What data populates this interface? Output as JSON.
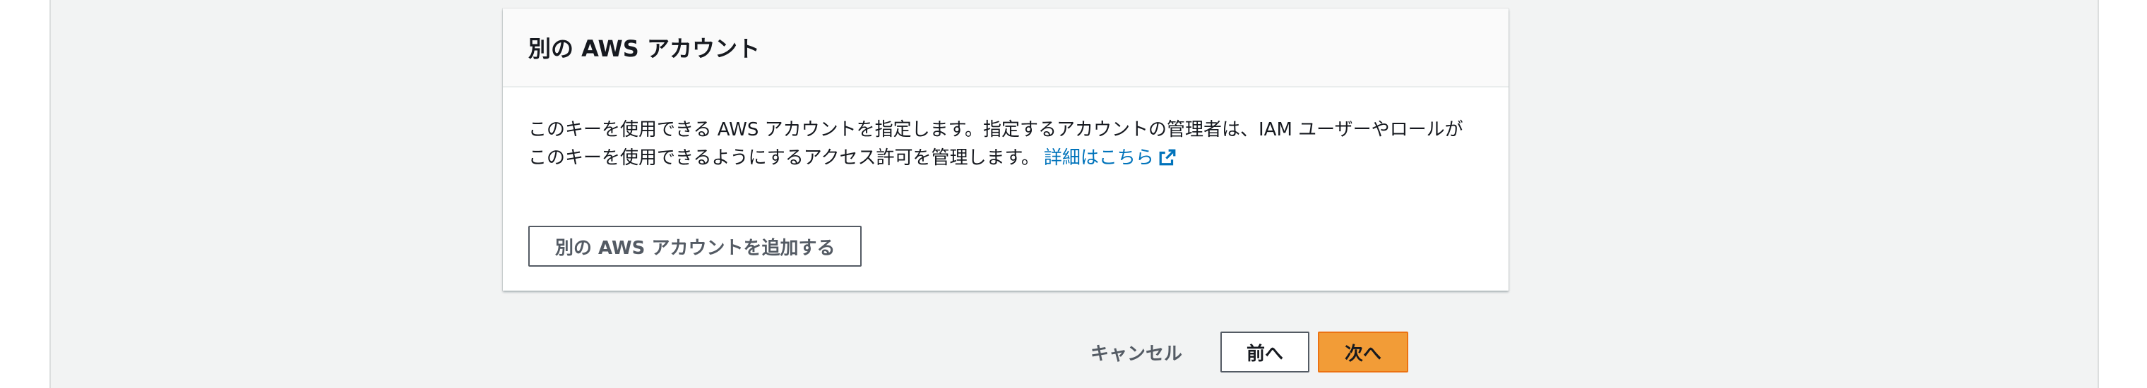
{
  "panel": {
    "title": "別の AWS アカウント",
    "description": "このキーを使用できる AWS アカウントを指定します。指定するアカウントの管理者は、IAM ユーザーやロールがこのキーを使用できるようにするアクセス許可を管理します。",
    "learn_more_label": "詳細はこちら",
    "add_account_label": "別の AWS アカウントを追加する"
  },
  "footer": {
    "cancel_label": "キャンセル",
    "previous_label": "前へ",
    "next_label": "次へ"
  },
  "icons": {
    "learn_more": "external-link-icon"
  },
  "colors": {
    "link": "#0073bb",
    "primary_button": "#f29c37",
    "page_background": "#f2f3f3"
  }
}
